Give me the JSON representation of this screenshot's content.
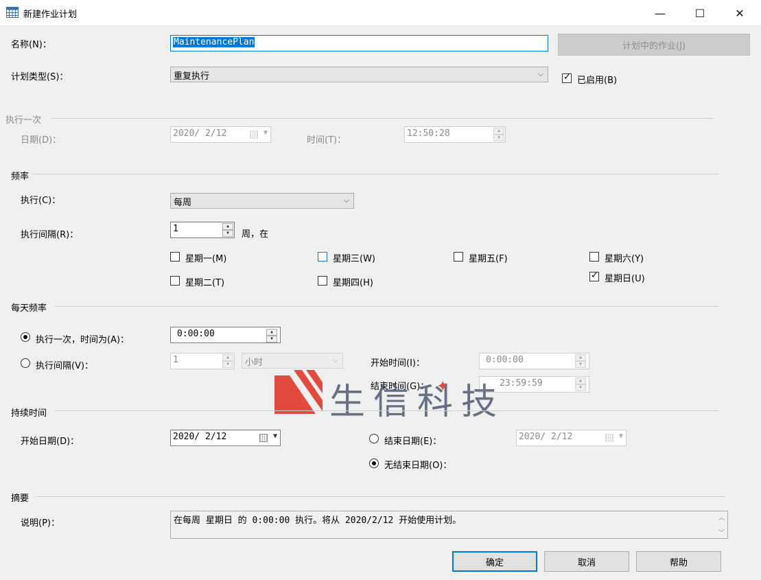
{
  "window": {
    "title": "新建作业计划",
    "minimize": "—",
    "maximize": "☐",
    "close": "✕"
  },
  "name": {
    "label": "名称(N)：",
    "value": "MaintenancePlan"
  },
  "jobs_button": "计划中的作业(J)",
  "schedule_type": {
    "label": "计划类型(S)：",
    "value": "重复执行"
  },
  "enabled": {
    "label": "已启用(B)",
    "checked": true
  },
  "one_time": {
    "heading": "执行一次",
    "date_label": "日期(D)：",
    "date_value": "2020/ 2/12",
    "time_label": "时间(T)：",
    "time_value": "12:50:28"
  },
  "frequency": {
    "heading": "频率",
    "occurs_label": "执行(C)：",
    "occurs_value": "每周",
    "recurs_label": "执行间隔(R)：",
    "recurs_value": "1",
    "recurs_suffix": "周，在",
    "days": {
      "mon": {
        "label": "星期一(M)",
        "checked": false
      },
      "tue": {
        "label": "星期二(T)",
        "checked": false
      },
      "wed": {
        "label": "星期三(W)",
        "checked": false
      },
      "thu": {
        "label": "星期四(H)",
        "checked": false
      },
      "fri": {
        "label": "星期五(F)",
        "checked": false
      },
      "sat": {
        "label": "星期六(Y)",
        "checked": false
      },
      "sun": {
        "label": "星期日(U)",
        "checked": true
      }
    }
  },
  "daily": {
    "heading": "每天频率",
    "once_label": "执行一次，时间为(A)：",
    "once_value": "0:00:00",
    "interval_label": "执行间隔(V)：",
    "interval_value": "1",
    "interval_unit": "小时",
    "start_label": "开始时间(I)：",
    "start_value": "0:00:00",
    "end_label": "结束时间(G)：",
    "end_value": "23:59:59"
  },
  "duration": {
    "heading": "持续时间",
    "start_label": "开始日期(D)：",
    "start_value": "2020/ 2/12",
    "end_label": "结束日期(E)：",
    "end_value": "2020/ 2/12",
    "no_end_label": "无结束日期(O)："
  },
  "summary": {
    "heading": "摘要",
    "desc_label": "说明(P)：",
    "desc_value": "在每周 星期日 的 0:00:00 执行。将从 2020/2/12 开始使用计划。"
  },
  "buttons": {
    "ok": "确定",
    "cancel": "取消",
    "help": "帮助"
  },
  "watermark": {
    "text": "生信科技",
    "color": "#e03020"
  }
}
